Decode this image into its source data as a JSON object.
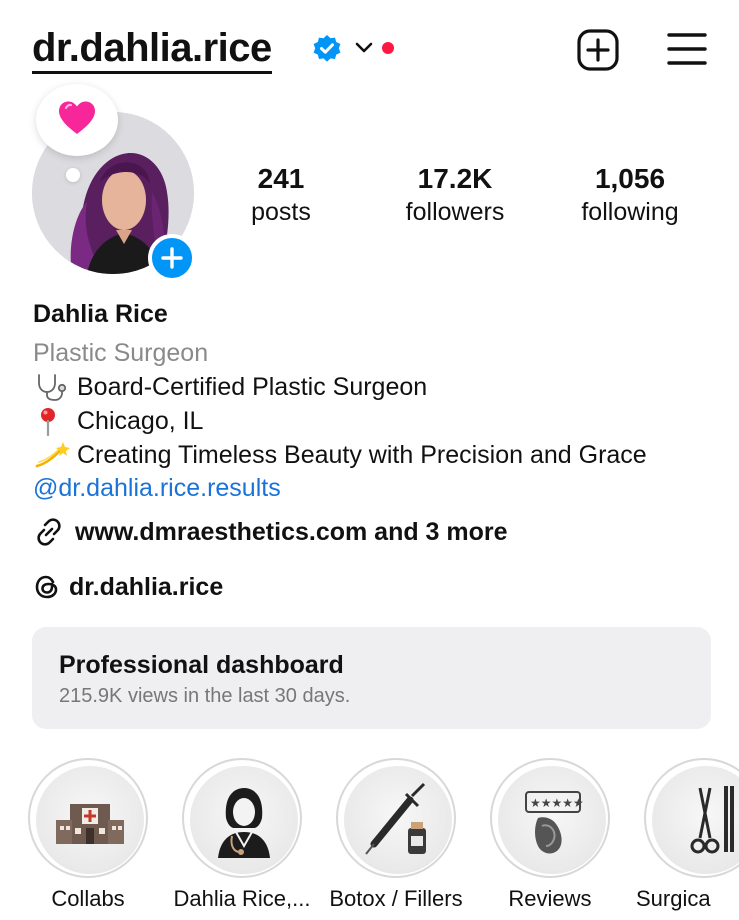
{
  "header": {
    "username": "dr.dahlia.rice",
    "verified_icon": "verified-badge-icon",
    "dropdown_icon": "chevron-down-icon",
    "notification_dot_color": "#ff1744",
    "create_icon": "plus-square-icon",
    "menu_icon": "hamburger-menu-icon"
  },
  "profile": {
    "note_emoji": "💗",
    "stats": {
      "posts_count": "241",
      "posts_label": "posts",
      "followers_count": "17.2K",
      "followers_label": "followers",
      "following_count": "1,056",
      "following_label": "following"
    }
  },
  "bio": {
    "name": "Dahlia Rice",
    "category": "Plastic Surgeon",
    "line1": "Board-Certified Plastic Surgeon",
    "line2": "Chicago, IL",
    "line3": "Creating Timeless Beauty with Precision and Grace",
    "mention": "@dr.dahlia.rice.results",
    "link": "www.dmraesthetics.com and 3 more",
    "threads": "dr.dahlia.rice"
  },
  "dashboard": {
    "title": "Professional dashboard",
    "subtitle": "215.9K views in the last 30 days."
  },
  "highlights": [
    {
      "label": "Collabs",
      "icon": "hospital-icon"
    },
    {
      "label": "Dahlia Rice,...",
      "icon": "doctor-icon"
    },
    {
      "label": "Botox / Fillers",
      "icon": "syringe-icon"
    },
    {
      "label": "Reviews",
      "icon": "review-stars-icon"
    },
    {
      "label": "Surgica",
      "icon": "surgical-tools-icon"
    }
  ],
  "colors": {
    "accent_blue": "#0095f6",
    "link_blue": "#1a73d9",
    "muted_text": "#8a8a8a",
    "card_bg": "#efeff1"
  }
}
